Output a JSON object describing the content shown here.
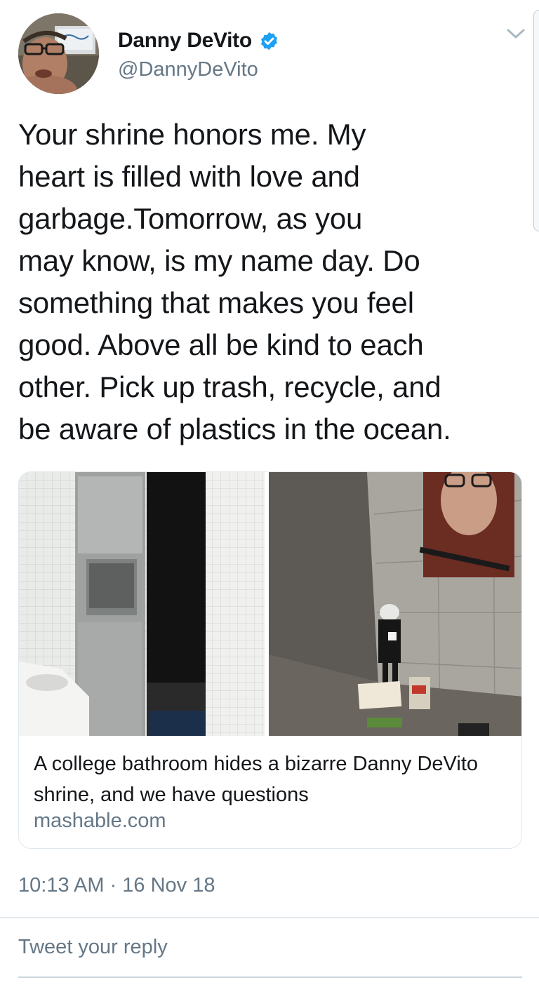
{
  "tweet": {
    "display_name": "Danny DeVito",
    "handle": "@DannyDeVito",
    "verified": true,
    "menu_icon": "chevron-down-icon",
    "text_lines": [
      "Your shrine honors me. My",
      "heart is filled with love and",
      "garbage.Tomorrow, as you",
      "may know, is my name day. Do",
      "something that makes you feel",
      "good. Above all be kind to each",
      "other. Pick up trash, recycle, and",
      "be aware of plastics in the ocean."
    ],
    "timestamp": "10:13 AM · 16 Nov 18"
  },
  "card": {
    "title": "A college bathroom hides a bizarre Danny DeVito shrine, and we have questions",
    "domain": "mashable.com",
    "left_image": "bathroom-stall-photo",
    "right_image": "shrine-photo"
  },
  "reply": {
    "placeholder": "Tweet your reply"
  },
  "colors": {
    "text": "#14171a",
    "secondary": "#657786",
    "verified_badge": "#1da1f2",
    "border": "#e1e8ed"
  }
}
